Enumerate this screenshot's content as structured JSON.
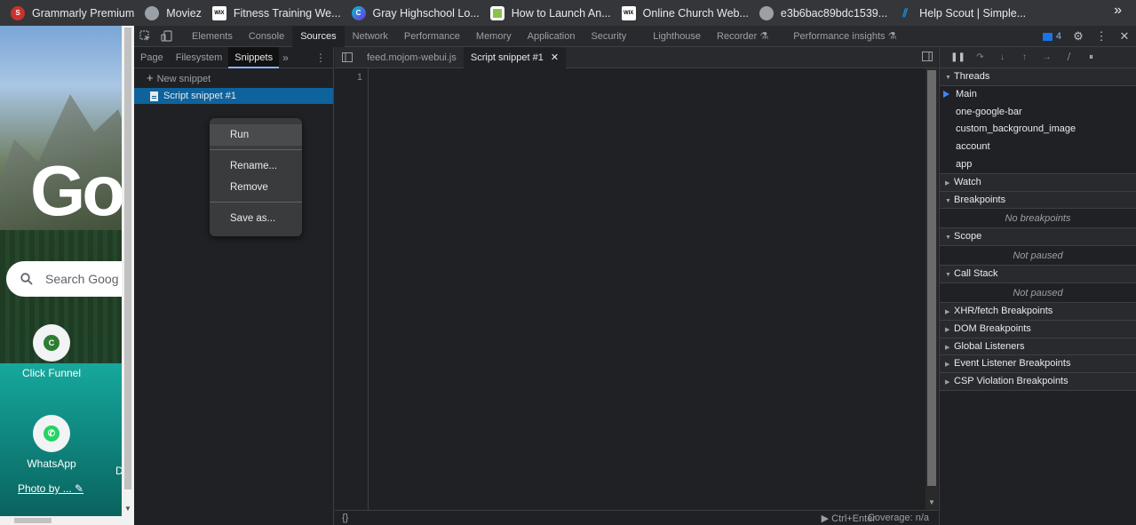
{
  "bookmarks": [
    {
      "label": "Grammarly Premium",
      "icon": "grammarly-icon",
      "color": "#c8332d",
      "glyph": "S"
    },
    {
      "label": "Moviez",
      "icon": "globe-icon",
      "color": "#9aa0a6",
      "glyph": ""
    },
    {
      "label": "Fitness Training We...",
      "icon": "wix-icon",
      "color": "#ffffff",
      "glyph": "WIX"
    },
    {
      "label": "Gray Highschool Lo...",
      "icon": "canva-icon",
      "color": "#7d2ae8",
      "glyph": "C"
    },
    {
      "label": "How to Launch An...",
      "icon": "green-circle-icon",
      "color": "#8bc34a",
      "glyph": ""
    },
    {
      "label": "Online Church Web...",
      "icon": "wix-icon",
      "color": "#ffffff",
      "glyph": "WIX"
    },
    {
      "label": "e3b6bac89bdc1539...",
      "icon": "globe-icon",
      "color": "#9aa0a6",
      "glyph": ""
    },
    {
      "label": "Help Scout | Simple...",
      "icon": "helpscout-icon",
      "color": "#1292ee",
      "glyph": ""
    }
  ],
  "bookmarks_more": "»",
  "newtab": {
    "logo": "Go",
    "search_placeholder": "Search Goog",
    "shortcuts": [
      {
        "label": "Click Funnel",
        "icon": "clickfunnel-icon",
        "color": "#2e7d32",
        "glyph": "C"
      },
      {
        "label": "WhatsApp",
        "icon": "whatsapp-icon",
        "color": "#25d366",
        "glyph": "✆"
      }
    ],
    "extra_letter": "D",
    "photo_by": "Photo by ..."
  },
  "devtools": {
    "tabs": [
      "Elements",
      "Console",
      "Sources",
      "Network",
      "Performance",
      "Memory",
      "Application",
      "Security",
      "Lighthouse",
      "Recorder ⚗",
      "Performance insights ⚗"
    ],
    "active_tab": "Sources",
    "issues_count": "4",
    "navigator": {
      "tabs": [
        "Page",
        "Filesystem",
        "Snippets"
      ],
      "active_tab": "Snippets",
      "more": "»",
      "new_snippet": "New snippet",
      "snippet_name": "Script snippet #1"
    },
    "context_menu": {
      "items": [
        "Run",
        "Rename...",
        "Remove",
        "Save as..."
      ]
    },
    "editor": {
      "tabs": [
        {
          "label": "feed.mojom-webui.js",
          "active": false
        },
        {
          "label": "Script snippet #1",
          "active": true
        }
      ],
      "line_numbers": [
        "1"
      ],
      "braces": "{}",
      "run_hint": "▶ Ctrl+Enter",
      "coverage": "Coverage: n/a"
    },
    "debugger": {
      "threads_title": "Threads",
      "threads": [
        "Main",
        "one-google-bar",
        "custom_background_image",
        "account",
        "app"
      ],
      "sections": [
        {
          "title": "Watch",
          "expanded": false,
          "empty": ""
        },
        {
          "title": "Breakpoints",
          "expanded": true,
          "empty": "No breakpoints"
        },
        {
          "title": "Scope",
          "expanded": true,
          "empty": "Not paused"
        },
        {
          "title": "Call Stack",
          "expanded": true,
          "empty": "Not paused"
        },
        {
          "title": "XHR/fetch Breakpoints",
          "expanded": false,
          "empty": ""
        },
        {
          "title": "DOM Breakpoints",
          "expanded": false,
          "empty": ""
        },
        {
          "title": "Global Listeners",
          "expanded": false,
          "empty": ""
        },
        {
          "title": "Event Listener Breakpoints",
          "expanded": false,
          "empty": ""
        },
        {
          "title": "CSP Violation Breakpoints",
          "expanded": false,
          "empty": ""
        }
      ]
    }
  }
}
